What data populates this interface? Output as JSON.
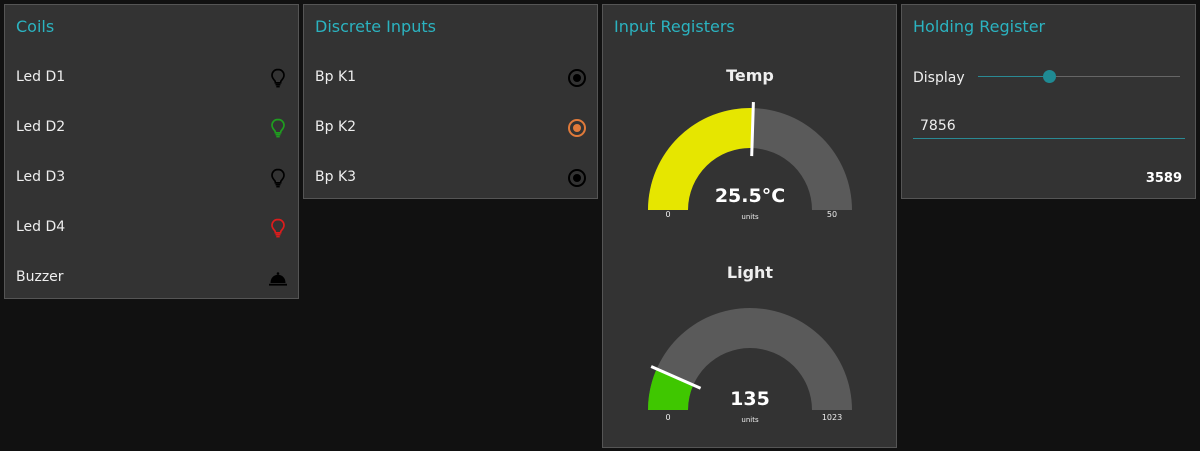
{
  "colors": {
    "accent": "#2bb3c0",
    "panel_bg": "#333333",
    "page_bg": "#111111",
    "led_on_green": "#1f9e1f",
    "led_on_red": "#dd1c1c",
    "led_off": "#000000",
    "input_active": "#e07a3a",
    "temp_fill": "#e6e600",
    "light_fill": "#3fc700",
    "gauge_bg": "#5a5a5a"
  },
  "coils": {
    "title": "Coils",
    "items": [
      {
        "label": "Led D1",
        "icon": "lightbulb-icon",
        "state": "off"
      },
      {
        "label": "Led D2",
        "icon": "lightbulb-icon",
        "state": "green"
      },
      {
        "label": "Led D3",
        "icon": "lightbulb-icon",
        "state": "off"
      },
      {
        "label": "Led D4",
        "icon": "lightbulb-icon",
        "state": "red"
      },
      {
        "label": "Buzzer",
        "icon": "bell-icon",
        "state": "off"
      }
    ]
  },
  "discrete_inputs": {
    "title": "Discrete Inputs",
    "items": [
      {
        "label": "Bp K1",
        "icon": "radio-icon",
        "state": "off"
      },
      {
        "label": "Bp K2",
        "icon": "radio-icon",
        "state": "on"
      },
      {
        "label": "Bp K3",
        "icon": "radio-icon",
        "state": "off"
      }
    ]
  },
  "input_registers": {
    "title": "Input Registers",
    "gauges": [
      {
        "title": "Temp",
        "value": 25.5,
        "display": "25.5°C",
        "units": "units",
        "min": 0,
        "max": 50,
        "min_label": "0",
        "max_label": "50"
      },
      {
        "title": "Light",
        "value": 135,
        "display": "135",
        "units": "units",
        "min": 0,
        "max": 1023,
        "min_label": "0",
        "max_label": "1023"
      }
    ]
  },
  "holding_register": {
    "title": "Holding Register",
    "slider_label": "Display",
    "slider_fraction": 0.35,
    "input_value": "7856",
    "value_text": "3589"
  }
}
